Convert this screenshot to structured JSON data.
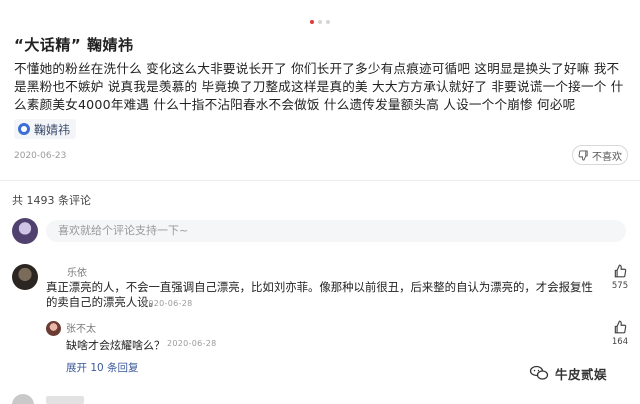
{
  "carousel": {
    "dots": 3,
    "active": 0,
    "active_color": "#e23a3a"
  },
  "post": {
    "title": "“大话精” 鞠婧祎",
    "body": "不懂她的粉丝在洗什么 变化这么大非要说长开了 你们长开了多少有点痕迹可循吧 这明显是换头了好嘛 我不是黑粉也不嫉妒 说真我是羡慕的 毕竟换了刀整成这样是真的美 大大方方承认就好了 非要说谎一个接一个 什么素颜美女4000年难遇 什么十指不沾阳春水不会做饭 什么遗传发量额头高 人设一个个崩惨 何必呢",
    "tag": "鞠婧祎",
    "tag_icon": "topic-icon",
    "date": "2020-06-23",
    "dislike_label": "不喜欢",
    "dislike_icon": "thumbs-down-icon"
  },
  "comments_header": {
    "count_text": "共 1493 条评论"
  },
  "comment_input": {
    "placeholder": "喜欢就给个评论支持一下~"
  },
  "comments": [
    {
      "user": "乐依",
      "text": "真正漂亮的人，不会一直强调自己漂亮，比如刘亦菲。像那种以前很丑，后来整的自认为漂亮的，才会报复性的卖自己的漂亮人设。",
      "date": "2020-06-28",
      "likes": "575",
      "like_icon": "thumbs-up-icon",
      "reply": {
        "user": "张不太",
        "text": "缺啥才会炫耀啥么？",
        "date": "2020-06-28",
        "likes": "164"
      },
      "expand_label": "展开 10 条回复"
    }
  ],
  "watermark": {
    "text": "牛皮贰娱",
    "icon": "wechat-icon"
  }
}
